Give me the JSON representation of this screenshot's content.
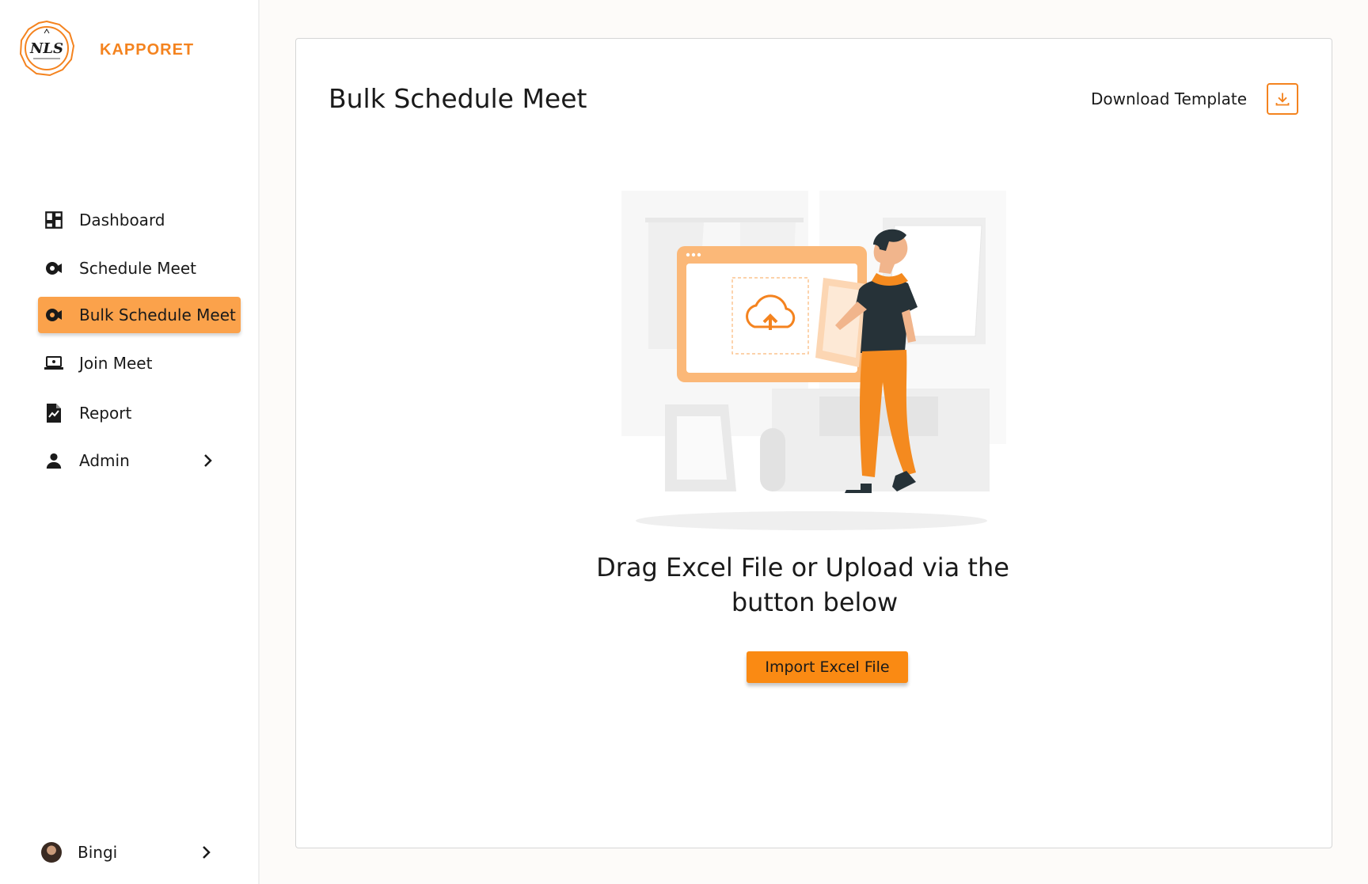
{
  "brand": {
    "name": "KAPPORET",
    "logo_text": "NLS",
    "color": "#f4831f"
  },
  "sidebar": {
    "items": [
      {
        "label": "Dashboard",
        "icon": "dashboard-icon",
        "active": false
      },
      {
        "label": "Schedule Meet",
        "icon": "video-camera-icon",
        "active": false
      },
      {
        "label": "Bulk Schedule Meet",
        "icon": "video-camera-icon",
        "active": true
      },
      {
        "label": "Join Meet",
        "icon": "laptop-icon",
        "active": false
      },
      {
        "label": "Report",
        "icon": "report-icon",
        "active": false
      },
      {
        "label": "Admin",
        "icon": "person-icon",
        "active": false,
        "has_submenu": true
      }
    ],
    "user": {
      "name": "Bingi",
      "icon": "avatar"
    }
  },
  "main": {
    "title": "Bulk Schedule Meet",
    "download_label": "Download Template",
    "download_icon": "download-icon",
    "drop_text_line1": "Drag Excel File or Upload via the",
    "drop_text_line2": "button below",
    "import_label": "Import Excel File"
  },
  "colors": {
    "accent": "#f4831f",
    "active_bg": "#fba24b",
    "button_bg": "#fa8a13"
  }
}
